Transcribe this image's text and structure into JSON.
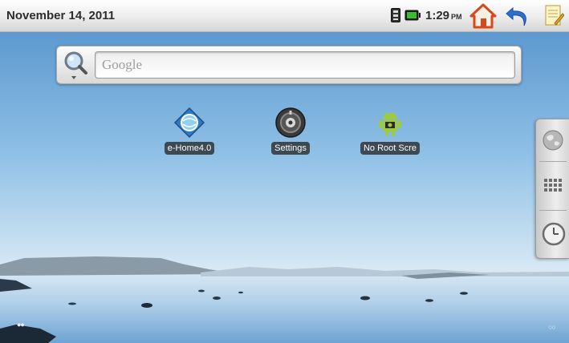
{
  "status_bar": {
    "date": "November 14, 2011",
    "time": "1:29",
    "ampm": "PM",
    "icons": [
      "sim-card-icon",
      "battery-icon",
      "home-icon",
      "back-arrow-icon",
      "notes-icon"
    ]
  },
  "search": {
    "placeholder": "Google",
    "icon": "search-magnifier-icon"
  },
  "apps": [
    {
      "label": "e-Home4.0",
      "icon": "ehome-globe-icon"
    },
    {
      "label": "Settings",
      "icon": "settings-icon"
    },
    {
      "label": "No Root Scre",
      "icon": "android-robot-icon"
    }
  ],
  "side_panel": {
    "icons": [
      "browser-globe-icon",
      "app-drawer-grid-icon",
      "clock-icon"
    ]
  },
  "page_indicators": {
    "left": "●●",
    "right": "○○"
  },
  "colors": {
    "sky": "#7fb3dd",
    "status_bar": "#ececec",
    "label_bg": "#282828"
  }
}
